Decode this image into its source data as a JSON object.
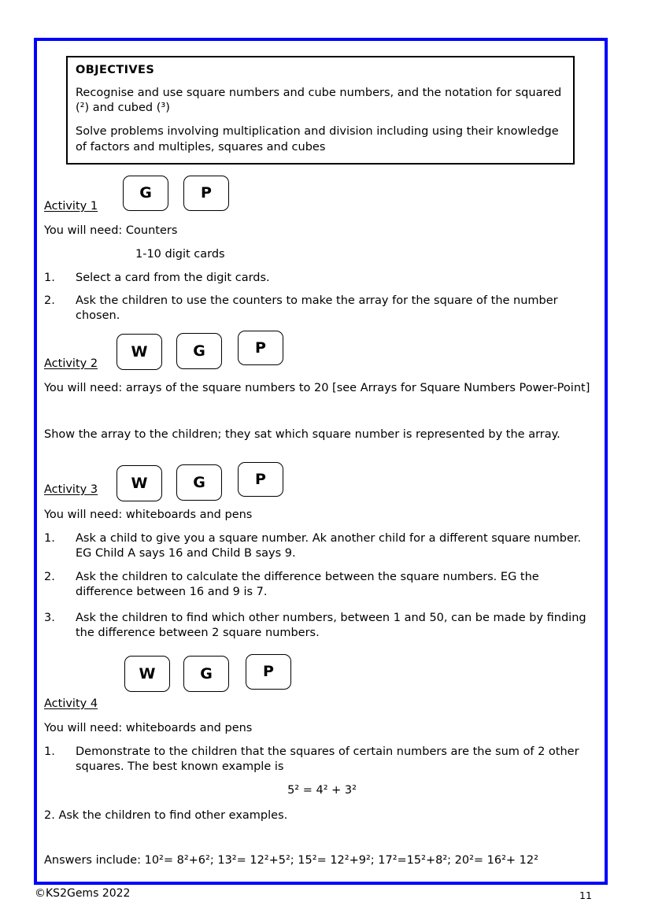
{
  "document": {
    "objectives": {
      "heading": "OBJECTIVES",
      "paragraph1": "Recognise and use square numbers and cube numbers, and the notation for squared (²) and cubed (³)",
      "paragraph2": "Solve problems involving multiplication and division including using their knowledge of factors and multiples, squares and cubes"
    },
    "activities": [
      {
        "label": "Activity 1",
        "badges": [
          "G",
          "P"
        ],
        "needs_line1": "You will need: Counters",
        "needs_line2": "1-10 digit cards",
        "steps": [
          {
            "num": "1.",
            "text": "Select a card from the digit cards."
          },
          {
            "num": "2.",
            "text": "Ask the children to use the counters to make the array for the square of the number chosen."
          }
        ]
      },
      {
        "label": "Activity 2",
        "badges": [
          "W",
          "G",
          "P"
        ],
        "needs_line1": "You will need: arrays of the square numbers to 20 [see Arrays for Square Numbers Power-Point]",
        "paragraph": "Show the array to the children; they sat which square number is represented by the array."
      },
      {
        "label": "Activity 3",
        "badges": [
          "W",
          "G",
          "P"
        ],
        "needs_line1": "You will need: whiteboards and pens",
        "steps": [
          {
            "num": "1.",
            "text": "Ask a child to give you a square number. Ak another child for a different square number. EG Child A says 16 and Child B says 9."
          },
          {
            "num": "2.",
            "text": "Ask the children to calculate the difference between the square numbers. EG the difference between 16 and 9 is 7."
          },
          {
            "num": "3.",
            "text": "Ask the children to find which other numbers, between 1 and 50, can be made by finding the difference between 2 square numbers."
          }
        ]
      },
      {
        "label": "Activity 4",
        "badges": [
          "W",
          "G",
          "P"
        ],
        "needs_line1": "You will need: whiteboards and pens",
        "steps": [
          {
            "num": "1.",
            "text": "Demonstrate to the children that the squares of certain numbers are the sum of 2 other squares. The best known example is"
          }
        ],
        "equation": "5² = 4² + 3²",
        "final_step": "2. Ask the children to find other examples."
      }
    ],
    "answers_line": "Answers include: 10²= 8²+6²; 13²= 12²+5²; 15²= 12²+9²; 17²=15²+8²; 20²= 16²+ 12²",
    "footer": {
      "copyright": "©KS2Gems 2022",
      "page_number": "11"
    },
    "colors": {
      "frame_blue": "#0000ff",
      "text_black": "#000000",
      "background": "#ffffff"
    }
  }
}
